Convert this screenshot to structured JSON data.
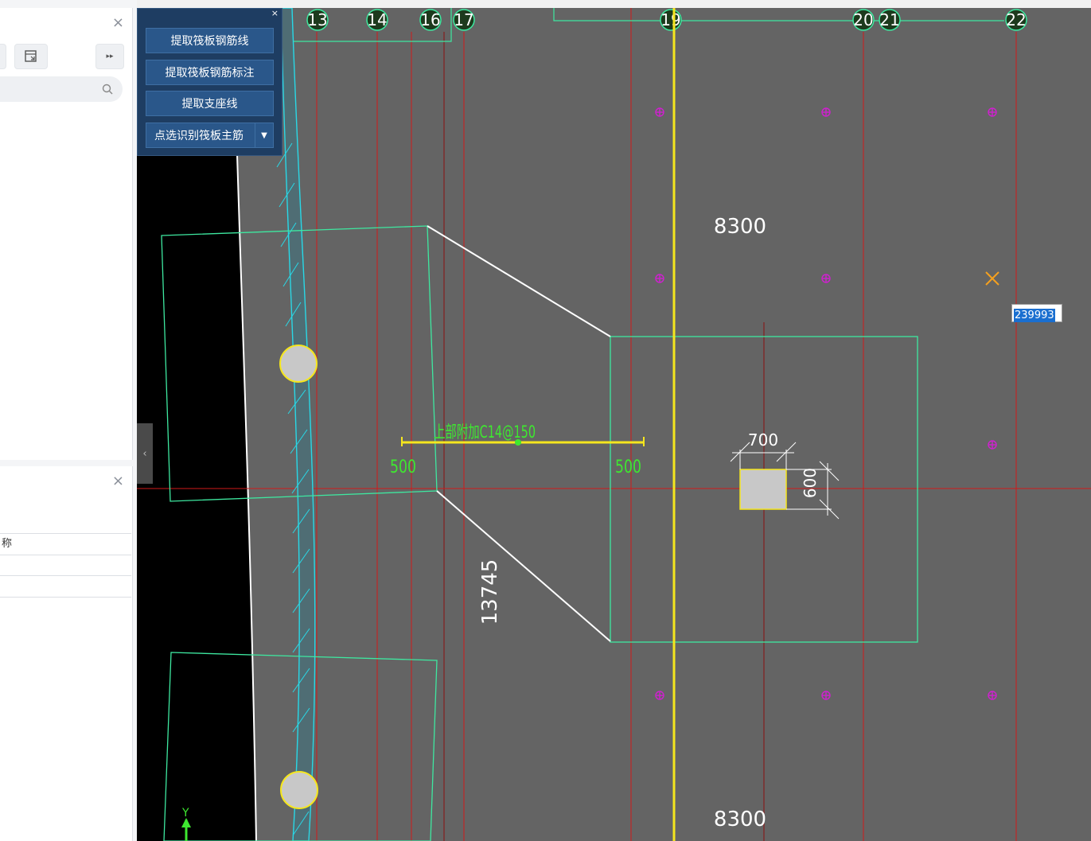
{
  "left_panel_top": {
    "close_label": "×",
    "more_label": "▸▸"
  },
  "left_panel_bottom": {
    "close_label": "×",
    "column_header": "称"
  },
  "command_panel": {
    "close_label": "×",
    "buttons": [
      {
        "label": "提取筏板钢筋线"
      },
      {
        "label": "提取筏板钢筋标注"
      },
      {
        "label": "提取支座线"
      },
      {
        "label": "点选识别筏板主筋"
      }
    ]
  },
  "axis_labels": [
    "13",
    "14",
    "16",
    "17",
    "19",
    "20",
    "21",
    "22"
  ],
  "dimensions": {
    "top_span": "8300",
    "bottom_span": "8300",
    "column_width": "700",
    "column_height": "600",
    "diagonal_length": "13745",
    "left_offset": "500",
    "right_offset": "500"
  },
  "rebar_annotation": "上部附加C14@150",
  "coordinate_input": "239993",
  "colors": {
    "canvas": "#646464",
    "grid_axis": "#d21a1a",
    "slab_outline": "#3ee8a0",
    "rebar_line": "#f5e61e",
    "support_line": "#ffffff",
    "marker": "#d020d0",
    "hatch": "#29d8e6"
  }
}
